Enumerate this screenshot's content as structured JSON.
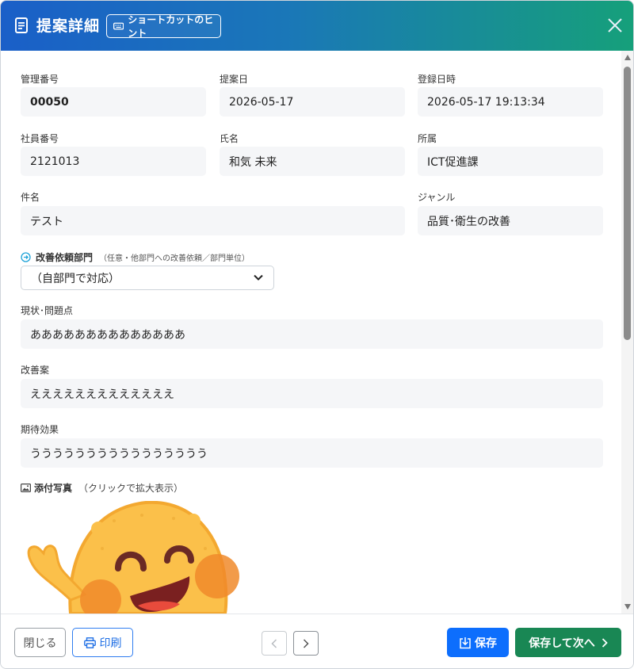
{
  "header": {
    "title": "提案詳細",
    "hint_button": "ショートカットのヒント"
  },
  "fields": {
    "mgmt_no": {
      "label": "管理番号",
      "value": "00050"
    },
    "proposal_date": {
      "label": "提案日",
      "value": "2026-05-17"
    },
    "registered_at": {
      "label": "登録日時",
      "value": "2026-05-17 19:13:34"
    },
    "employee_no": {
      "label": "社員番号",
      "value": "2121013"
    },
    "name": {
      "label": "氏名",
      "value": "和気 未来"
    },
    "department": {
      "label": "所属",
      "value": "ICT促進課"
    },
    "subject": {
      "label": "件名",
      "value": "テスト"
    },
    "genre": {
      "label": "ジャンル",
      "value": "品質･衛生の改善"
    },
    "request_dept": {
      "label": "改善依頼部門",
      "note": "（任意・他部門への改善依頼／部門単位）",
      "selected": "（自部門で対応）"
    },
    "current_issue": {
      "label": "現状･問題点",
      "value": "ああああああああああああああ"
    },
    "improvement": {
      "label": "改善案",
      "value": "えええええええええええええ"
    },
    "expected_effect": {
      "label": "期待効果",
      "value": "うううううううううううううううう"
    },
    "photo": {
      "label": "添付写真",
      "note": "（クリックで拡大表示）"
    }
  },
  "footer": {
    "close": "閉じる",
    "print": "印刷",
    "save": "保存",
    "save_next": "保存して次へ"
  },
  "colors": {
    "header_start": "#1a5fc8",
    "header_end": "#16a07a",
    "primary": "#0d6efd",
    "success": "#198754"
  }
}
